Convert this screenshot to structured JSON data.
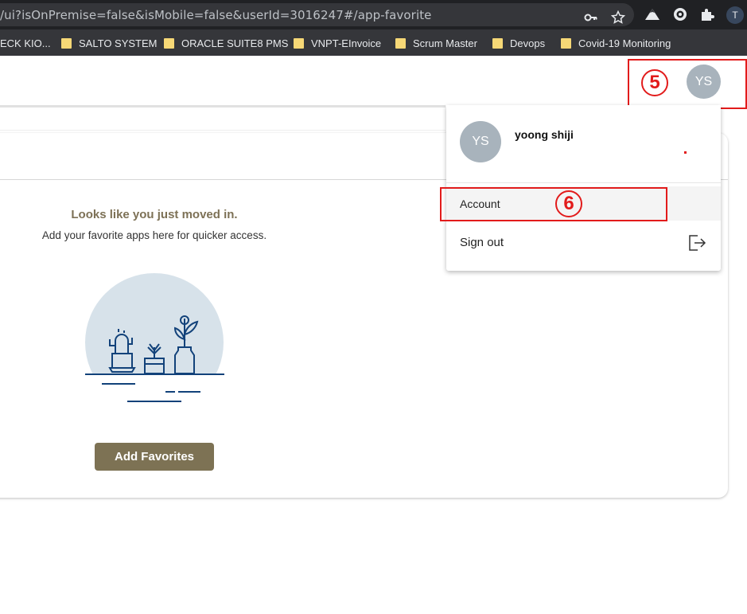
{
  "browser": {
    "url": "/ui?isOnPremise=false&isMobile=false&userId=3016247#/app-favorite",
    "profile_initial": "T",
    "icons": [
      "key-icon",
      "star-icon",
      "mountain-extension-icon",
      "shield-extension-icon",
      "puzzle-extension-icon"
    ]
  },
  "bookmarks": [
    {
      "label": "ECK KIO..."
    },
    {
      "label": "SALTO SYSTEM"
    },
    {
      "label": "ORACLE SUITE8 PMS"
    },
    {
      "label": "VNPT-EInvoice"
    },
    {
      "label": "Scrum Master"
    },
    {
      "label": "Devops"
    },
    {
      "label": "Covid-19 Monitoring"
    }
  ],
  "header": {
    "avatar_initials": "YS"
  },
  "annotations": {
    "step5": "5",
    "step6": "6",
    "color": "#e21b1b"
  },
  "empty_state": {
    "title": "Looks like you just moved in.",
    "subtitle": "Add your favorite apps here for quicker access.",
    "button_label": "Add Favorites",
    "accent_color": "#7d7254"
  },
  "user_menu": {
    "avatar_initials": "YS",
    "user_name": "yoong shiji",
    "items": [
      {
        "label": "Account"
      },
      {
        "label": "Sign out"
      }
    ]
  }
}
